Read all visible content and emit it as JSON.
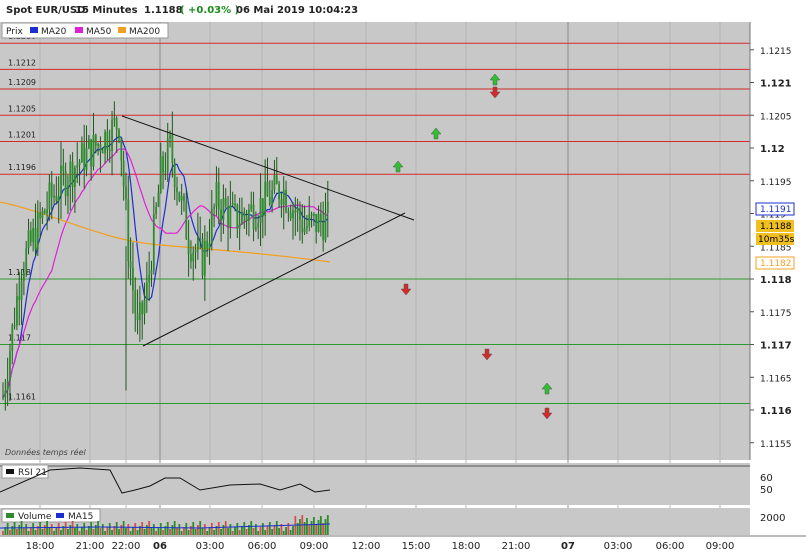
{
  "header": {
    "instrument": "Spot EUR/USD",
    "timeframe": "15 Minutes",
    "price": "1.1188",
    "change": "( +0.03% )",
    "datetime": "06 Mai 2019 10:04:23"
  },
  "legend": {
    "price_label": "Prix",
    "items": [
      {
        "name": "MA20",
        "color": "#1a2fd0"
      },
      {
        "name": "MA50",
        "color": "#e020d8"
      },
      {
        "name": "MA200",
        "color": "#f0a020"
      }
    ]
  },
  "colors": {
    "background": "#c8c8c8",
    "grid": "#b4b4b4",
    "candle": "#2e8b2e",
    "resistance": "#d42a2a",
    "support": "#2e9a2e",
    "ma20": "#1a2fd0",
    "ma50": "#e020d8",
    "ma200": "#f0a020"
  },
  "realtime_label": "Données temps réel",
  "price_badges": {
    "ma20": "1.1191",
    "last": "1.1188",
    "countdown": "10m35s",
    "ma200": "1.1182"
  },
  "chart_data": {
    "type": "candlestick",
    "y_ticks": [
      "1.1215",
      "1.121",
      "1.1205",
      "1.12",
      "1.1195",
      "1.119",
      "1.1185",
      "1.118",
      "1.1175",
      "1.117",
      "1.1165",
      "1.116",
      "1.1155"
    ],
    "x_ticks": [
      "18:00",
      "21:00",
      "22:00",
      "06",
      "03:00",
      "06:00",
      "09:00",
      "12:00",
      "15:00",
      "18:00",
      "21:00",
      "07",
      "03:00",
      "06:00",
      "09:00"
    ],
    "resistance_levels": [
      "1.1216",
      "1.1212",
      "1.1209",
      "1.1205",
      "1.1201",
      "1.1196"
    ],
    "support_levels": [
      "1.118",
      "1.117",
      "1.1161"
    ],
    "left_level_labels": [
      "1.1216",
      "1.1212",
      "1.1209",
      "1.1205",
      "1.1201",
      "1.1196",
      "1.118",
      "1.117",
      "1.1161"
    ],
    "rsi": {
      "name": "RSI 21",
      "ticks": [
        "60",
        "50"
      ]
    },
    "volume": {
      "name": "Volume",
      "ma": "MA15",
      "ticks": [
        "2000"
      ]
    }
  }
}
